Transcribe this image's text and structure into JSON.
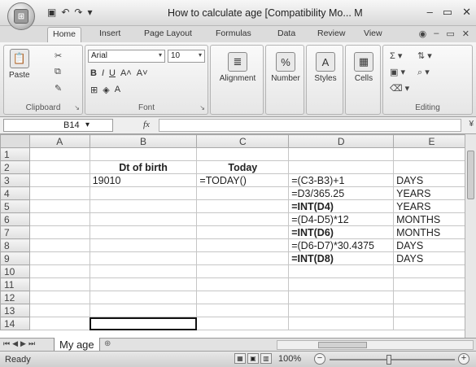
{
  "window": {
    "title": "How to calculate age  [Compatibility Mo... M",
    "controls": [
      "–",
      "▭",
      "✕"
    ]
  },
  "ribbon_tabs": [
    "Home",
    "Insert",
    "Page Layout",
    "Formulas",
    "Data",
    "Review",
    "View"
  ],
  "ribbon": {
    "clipboard": {
      "paste": "Paste",
      "label": "Clipboard"
    },
    "font": {
      "name": "Arial",
      "size": "10",
      "label": "Font"
    },
    "alignment": {
      "label": "Alignment"
    },
    "number": {
      "label": "Number",
      "icon_text": "%"
    },
    "styles": {
      "label": "Styles"
    },
    "cells": {
      "label": "Cells"
    },
    "editing": {
      "label": "Editing"
    }
  },
  "formula_bar": {
    "name_box": "B14",
    "fx": "fx",
    "value": ""
  },
  "columns": [
    "A",
    "B",
    "C",
    "D",
    "E"
  ],
  "rows": [
    {
      "num": "1",
      "cells": [
        "",
        "",
        "",
        "",
        ""
      ]
    },
    {
      "num": "2",
      "cells": [
        "",
        "Dt of birth",
        "Today",
        "",
        ""
      ]
    },
    {
      "num": "3",
      "cells": [
        "",
        "19010",
        "=TODAY()",
        "=(C3-B3)+1",
        "DAYS"
      ]
    },
    {
      "num": "4",
      "cells": [
        "",
        "",
        "",
        "=D3/365.25",
        "YEARS"
      ]
    },
    {
      "num": "5",
      "cells": [
        "",
        "",
        "",
        "=INT(D4)",
        "YEARS"
      ]
    },
    {
      "num": "6",
      "cells": [
        "",
        "",
        "",
        "=(D4-D5)*12",
        "MONTHS"
      ]
    },
    {
      "num": "7",
      "cells": [
        "",
        "",
        "",
        "=INT(D6)",
        "MONTHS"
      ]
    },
    {
      "num": "8",
      "cells": [
        "",
        "",
        "",
        "=(D6-D7)*30.4375",
        "DAYS"
      ]
    },
    {
      "num": "9",
      "cells": [
        "",
        "",
        "",
        "=INT(D8)",
        "DAYS"
      ]
    },
    {
      "num": "10",
      "cells": [
        "",
        "",
        "",
        "",
        ""
      ]
    },
    {
      "num": "11",
      "cells": [
        "",
        "",
        "",
        "",
        ""
      ]
    },
    {
      "num": "12",
      "cells": [
        "",
        "",
        "",
        "",
        ""
      ]
    },
    {
      "num": "13",
      "cells": [
        "",
        "",
        "",
        "",
        ""
      ]
    },
    {
      "num": "14",
      "cells": [
        "",
        "",
        "",
        "",
        ""
      ]
    }
  ],
  "bold_cells": [
    "B2",
    "C2",
    "D5",
    "D7",
    "D9"
  ],
  "selected_cell": "B14",
  "sheet_tabs": [
    "My age"
  ],
  "status": {
    "text": "Ready",
    "zoom": "100%"
  }
}
